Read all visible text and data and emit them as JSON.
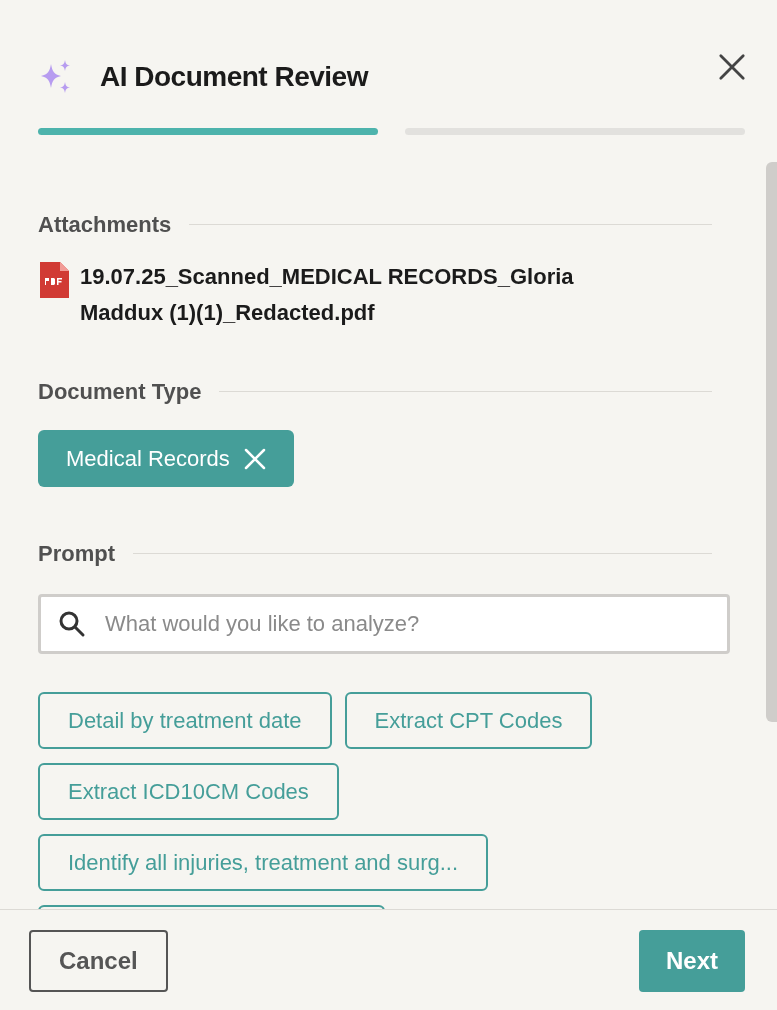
{
  "dialog": {
    "title": "AI Document Review"
  },
  "steps": [
    {
      "selected": true
    },
    {
      "selected": false
    }
  ],
  "attachments": {
    "heading": "Attachments",
    "files": [
      {
        "name": "19.07.25_Scanned_MEDICAL RECORDS_Gloria Maddux (1)(1)_Redacted.pdf"
      }
    ]
  },
  "document_type": {
    "heading": "Document Type",
    "tags": [
      {
        "label": "Medical Records"
      }
    ]
  },
  "prompt": {
    "heading": "Prompt",
    "search": {
      "placeholder": "What would you like to analyze?"
    },
    "suggestions": [
      {
        "kind": "chip",
        "label": "Detail by treatment date"
      },
      {
        "kind": "chip",
        "label": "Extract CPT Codes"
      },
      {
        "kind": "chip",
        "label": "Extract ICD10CM Codes"
      },
      {
        "kind": "chip",
        "label": "Identify all injuries, treatment and surg..."
      },
      {
        "kind": "cut_off"
      }
    ]
  },
  "footer": {
    "buttons": [
      {
        "kind": "secondary",
        "label": "Cancel"
      },
      {
        "kind": "primary",
        "label": "Next"
      }
    ]
  }
}
